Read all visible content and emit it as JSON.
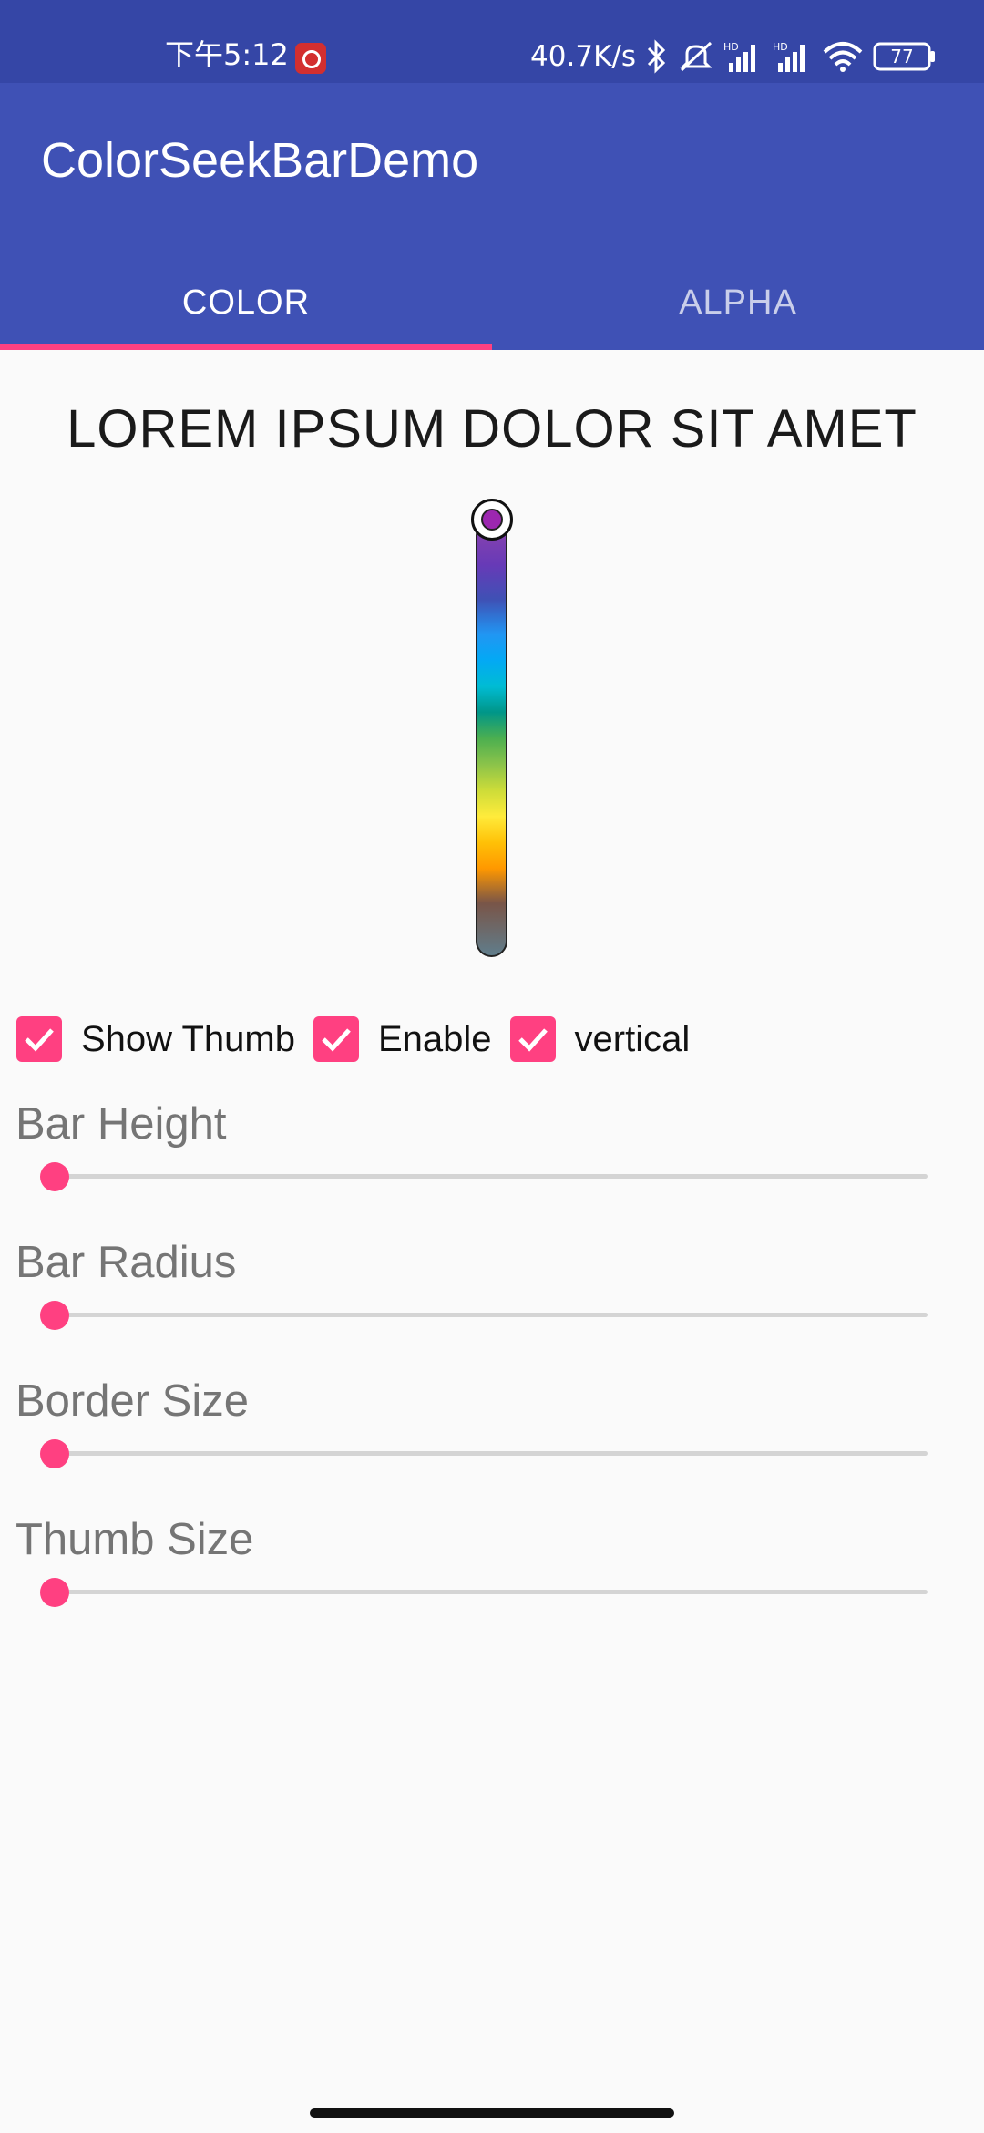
{
  "status_bar": {
    "time": "下午5:12",
    "net_speed": "40.7K/s",
    "battery": "77",
    "icons": [
      "notification-app-icon",
      "bluetooth-icon",
      "mute-icon",
      "hd-signal-icon",
      "hd-signal-icon",
      "wifi-icon",
      "battery-icon"
    ]
  },
  "app_bar": {
    "title": "ColorSeekBarDemo",
    "color": "#3f51b5"
  },
  "tabs": [
    {
      "label": "COLOR",
      "selected": true
    },
    {
      "label": "ALPHA",
      "selected": false
    }
  ],
  "accent_color": "#ff4081",
  "headline": "LOREM IPSUM DOLOR SIT AMET",
  "color_seek_bar": {
    "orientation": "vertical",
    "selected_color": "#9c27b0",
    "thumb_position": 0
  },
  "checkboxes": [
    {
      "label": "Show Thumb",
      "checked": true
    },
    {
      "label": "Enable",
      "checked": true
    },
    {
      "label": "vertical",
      "checked": true
    }
  ],
  "sliders": [
    {
      "label": "Bar Height",
      "value": 0
    },
    {
      "label": "Bar Radius",
      "value": 0
    },
    {
      "label": "Border Size",
      "value": 0
    },
    {
      "label": "Thumb Size",
      "value": 0
    }
  ]
}
